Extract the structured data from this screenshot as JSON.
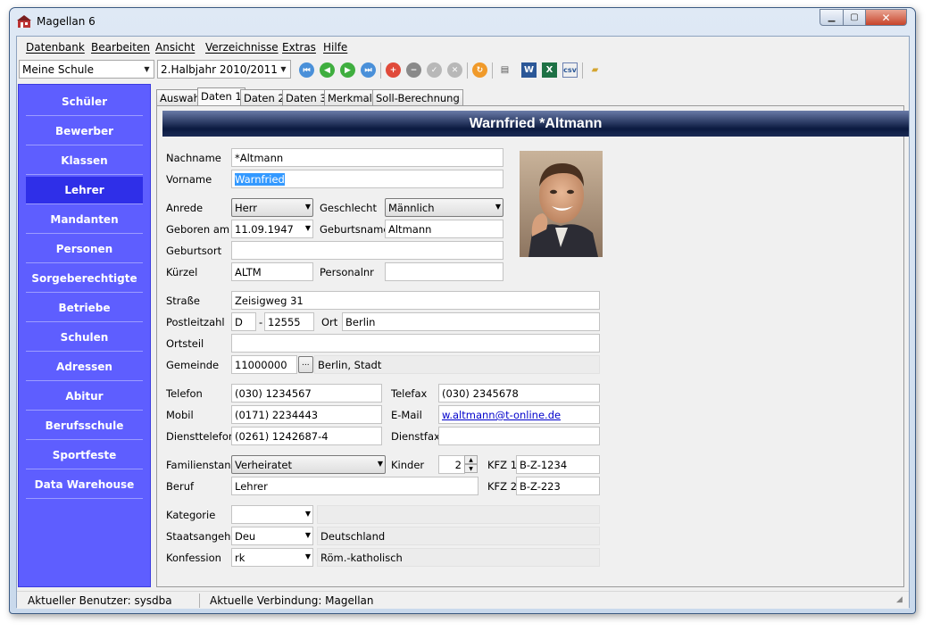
{
  "window": {
    "title": "Magellan 6"
  },
  "menu": [
    "Datenbank",
    "Bearbeiten",
    "Ansicht",
    "Verzeichnisse",
    "Extras",
    "Hilfe"
  ],
  "toolbar": {
    "school": "Meine Schule",
    "term": "2.Halbjahr 2010/2011",
    "icons": [
      "first-record-icon",
      "prev-record-icon",
      "next-record-icon",
      "last-record-icon",
      "add-record-icon",
      "delete-record-icon",
      "confirm-icon",
      "cancel-icon",
      "refresh-icon",
      "print-icon",
      "word-export-icon",
      "excel-export-icon",
      "csv-export-icon",
      "open-folder-icon"
    ]
  },
  "sidebar": {
    "active": "Lehrer",
    "items": [
      "Schüler",
      "Bewerber",
      "Klassen",
      "Lehrer",
      "Mandanten",
      "Personen",
      "Sorgeberechtigte",
      "Betriebe",
      "Schulen",
      "Adressen",
      "Abitur",
      "Berufsschule",
      "Sportfeste",
      "Data Warehouse"
    ]
  },
  "tabs": {
    "active": "Daten 1",
    "items": [
      "Auswahl",
      "Daten 1",
      "Daten 2",
      "Daten 3",
      "Merkmale",
      "Soll-Berechnung"
    ]
  },
  "record": {
    "header": "Warnfried *Altmann",
    "labels": {
      "nachname": "Nachname",
      "vorname": "Vorname",
      "anrede": "Anrede",
      "geschlecht": "Geschlecht",
      "geboren": "Geboren am",
      "geburtsname": "Geburtsname",
      "geburtsort": "Geburtsort",
      "kuerzel": "Kürzel",
      "personalnr": "Personalnr",
      "strasse": "Straße",
      "plz": "Postleitzahl",
      "ort": "Ort",
      "ortsteil": "Ortsteil",
      "gemeinde": "Gemeinde",
      "telefon": "Telefon",
      "telefax": "Telefax",
      "mobil": "Mobil",
      "email": "E-Mail",
      "diensttelefon": "Diensttelefon",
      "dienstfax": "Dienstfax",
      "familienstand": "Familienstand",
      "kinder": "Kinder",
      "kfz1": "KFZ 1",
      "kfz2": "KFZ 2",
      "beruf": "Beruf",
      "kategorie": "Kategorie",
      "staatsangeh": "Staatsangeh.",
      "konfession": "Konfession"
    },
    "values": {
      "nachname": "*Altmann",
      "vorname": "Warnfried",
      "anrede": "Herr",
      "geschlecht": "Männlich",
      "geboren": "11.09.1947",
      "geburtsname": "Altmann",
      "geburtsort": "",
      "kuerzel": "ALTM",
      "personalnr": "",
      "strasse": "Zeisigweg 31",
      "plz_country": "D",
      "plz_sep": "-",
      "plz": "12555",
      "ort": "Berlin",
      "ortsteil": "",
      "gemeinde_code": "11000000",
      "gemeinde_browse": "...",
      "gemeinde_name": "Berlin, Stadt",
      "telefon": "(030) 1234567",
      "telefax": "(030) 2345678",
      "mobil": "(0171) 2234443",
      "email": "w.altmann@t-online.de",
      "diensttelefon": "(0261) 1242687-4",
      "dienstfax": "",
      "familienstand": "Verheiratet",
      "kinder": "2",
      "kfz1": "B-Z-1234",
      "kfz2": "B-Z-223",
      "beruf": "Lehrer",
      "kategorie": "",
      "kategorie_text": "",
      "staatsangeh": "Deu",
      "staatsangeh_text": "Deutschland",
      "konfession": "rk",
      "konfession_text": "Röm.-katholisch"
    }
  },
  "status": {
    "user": "Aktueller Benutzer: sysdba",
    "connection": "Aktuelle Verbindung: Magellan"
  }
}
